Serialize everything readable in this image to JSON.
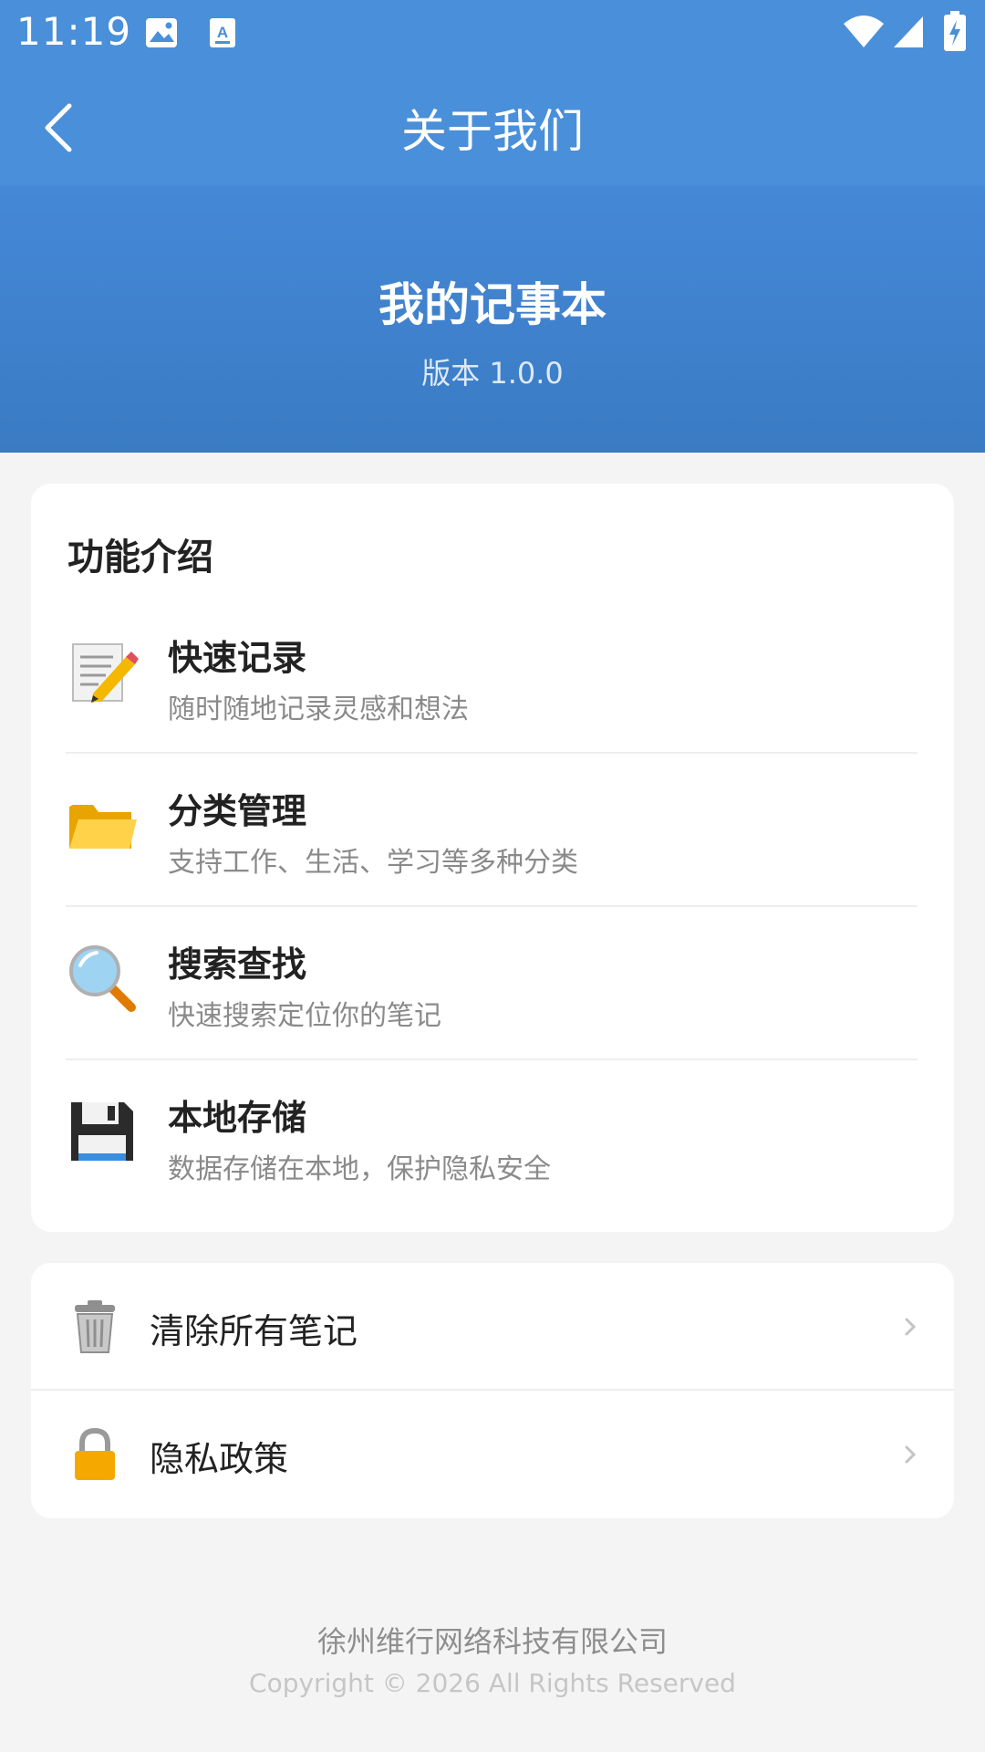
{
  "status_bar": {
    "time": "11:19",
    "icons": [
      "image-icon",
      "text-a-icon",
      "wifi-icon",
      "signal-icon",
      "battery-charging-icon"
    ]
  },
  "toolbar": {
    "back_icon": "chevron-left-icon",
    "title": "关于我们"
  },
  "header": {
    "app_name": "我的记事本",
    "version": "版本 1.0.0"
  },
  "features": {
    "title": "功能介绍",
    "items": [
      {
        "icon": "memo-icon",
        "title": "快速记录",
        "desc": "随时随地记录灵感和想法"
      },
      {
        "icon": "folder-icon",
        "title": "分类管理",
        "desc": "支持工作、生活、学习等多种分类"
      },
      {
        "icon": "magnifier-icon",
        "title": "搜索查找",
        "desc": "快速搜索定位你的笔记"
      },
      {
        "icon": "floppy-disk-icon",
        "title": "本地存储",
        "desc": "数据存储在本地，保护隐私安全"
      }
    ]
  },
  "actions": [
    {
      "icon": "trash-icon",
      "label": "清除所有笔记"
    },
    {
      "icon": "lock-icon",
      "label": "隐私政策"
    }
  ],
  "footer": {
    "company": "徐州维行网络科技有限公司",
    "copyright": "Copyright © 2026 All Rights Reserved"
  },
  "colors": {
    "primary": "#4a8fd9",
    "header_gradient_end": "#3a7bc4",
    "background": "#f4f4f4"
  }
}
